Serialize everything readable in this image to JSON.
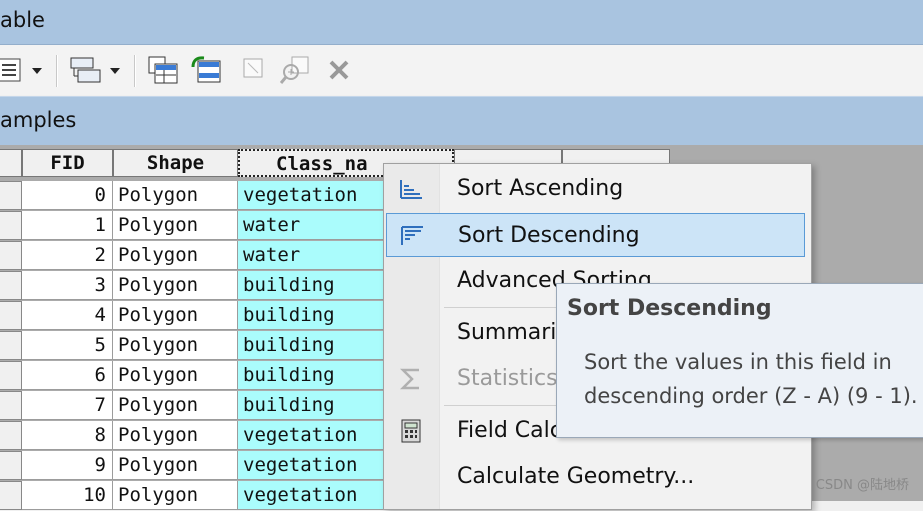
{
  "window": {
    "title": "able"
  },
  "tab": {
    "title": "amples"
  },
  "toolbar": {
    "icons": [
      "table-options-icon",
      "dropdown-arrow-icon",
      "related-tables-icon",
      "dropdown-arrow-icon",
      "select-by-attributes-icon",
      "switch-selection-icon",
      "clear-selection-icon",
      "zoom-to-selected-icon",
      "delete-selected-icon"
    ]
  },
  "table": {
    "columns": [
      "FID",
      "Shape",
      "Class_na",
      "",
      ""
    ],
    "rows": [
      {
        "fid": "0",
        "shape": "Polygon",
        "class": "vegetation"
      },
      {
        "fid": "1",
        "shape": "Polygon",
        "class": "water"
      },
      {
        "fid": "2",
        "shape": "Polygon",
        "class": "water"
      },
      {
        "fid": "3",
        "shape": "Polygon",
        "class": "building"
      },
      {
        "fid": "4",
        "shape": "Polygon",
        "class": "building"
      },
      {
        "fid": "5",
        "shape": "Polygon",
        "class": "building"
      },
      {
        "fid": "6",
        "shape": "Polygon",
        "class": "building"
      },
      {
        "fid": "7",
        "shape": "Polygon",
        "class": "building"
      },
      {
        "fid": "8",
        "shape": "Polygon",
        "class": "vegetation"
      },
      {
        "fid": "9",
        "shape": "Polygon",
        "class": "vegetation"
      },
      {
        "fid": "10",
        "shape": "Polygon",
        "class": "vegetation"
      }
    ]
  },
  "context_menu": {
    "items": [
      {
        "label": "Sort Ascending",
        "icon": "sort-ascending-icon"
      },
      {
        "label": "Sort Descending",
        "icon": "sort-descending-icon",
        "highlighted": true
      },
      {
        "label": "Advanced Sorting...",
        "icon": ""
      },
      {
        "label": "Summarize...",
        "icon": ""
      },
      {
        "label": "Statistics...",
        "icon": "sigma-icon",
        "disabled": true
      },
      {
        "label": "Field Calculator...",
        "icon": "calculator-icon"
      },
      {
        "label": "Calculate Geometry...",
        "icon": ""
      }
    ]
  },
  "tooltip": {
    "title": "Sort Descending",
    "line1": "Sort the values in this field in",
    "line2": "descending order (Z - A) (9 - 1)."
  },
  "watermark": "CSDN @陆地桥",
  "colors": {
    "selected_column": "#aafcfc",
    "highlight": "#cce4f7",
    "titlebar": "#a9c4e0"
  }
}
